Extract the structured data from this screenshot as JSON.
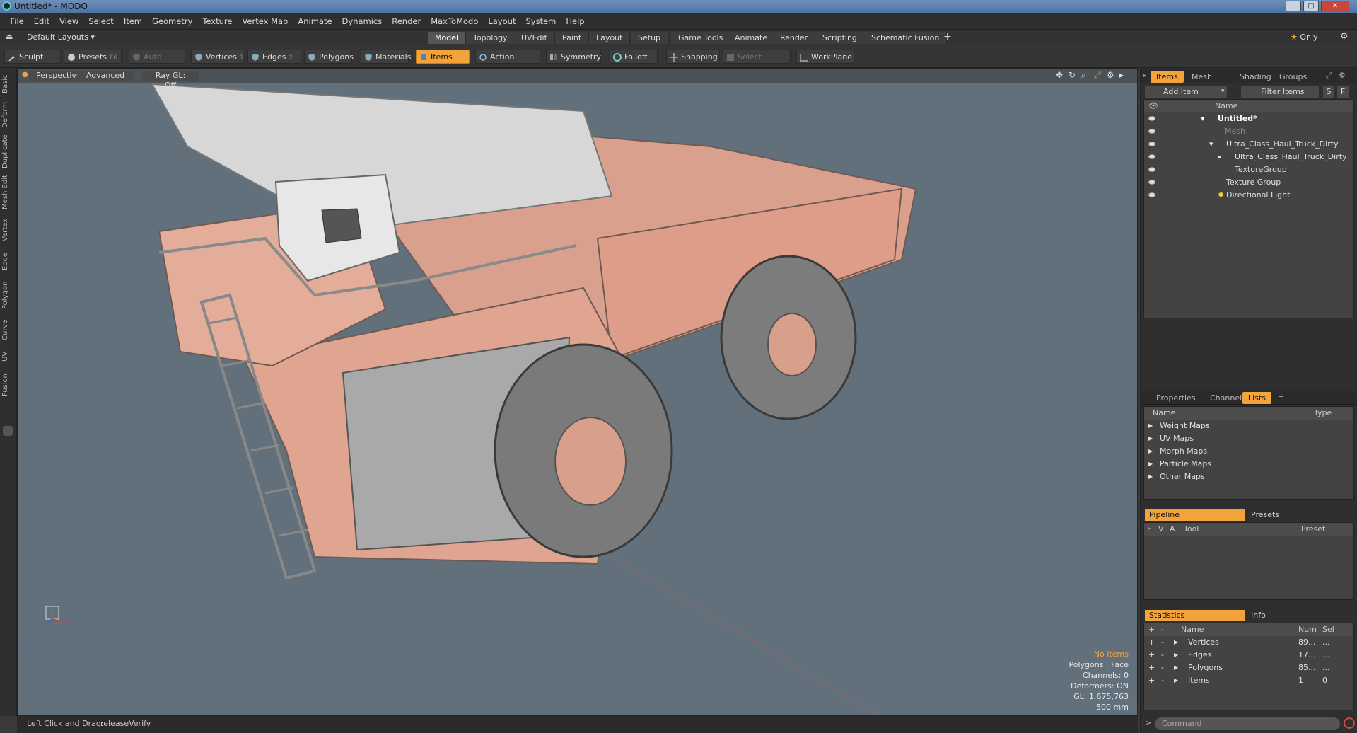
{
  "window": {
    "title": "Untitled* - MODO"
  },
  "menu": [
    "File",
    "Edit",
    "View",
    "Select",
    "Item",
    "Geometry",
    "Texture",
    "Vertex Map",
    "Animate",
    "Dynamics",
    "Render",
    "MaxToModo",
    "Layout",
    "System",
    "Help"
  ],
  "layoutbar": {
    "layout_name": "Default Layouts",
    "tabs": [
      "Model",
      "Topology",
      "UVEdit",
      "Paint",
      "Layout",
      "Setup",
      "Game Tools",
      "Animate",
      "Render",
      "Scripting",
      "Schematic Fusion"
    ],
    "active_tab": "Model",
    "plus": "+",
    "only_label": "Only"
  },
  "toolbar": {
    "sculpt": "Sculpt",
    "presets": "Presets",
    "presets_key": "F6",
    "auto_select": "Auto Select",
    "vertices": "Vertices",
    "vertices_count": "1",
    "edges": "Edges",
    "edges_count": "2",
    "polygons": "Polygons",
    "materials": "Materials",
    "items": "Items",
    "action_center": "Action Center",
    "symmetry": "Symmetry",
    "falloff": "Falloff",
    "snapping": "Snapping",
    "select_through": "Select Through",
    "workplane": "WorkPlane"
  },
  "left_tabs": [
    "Basic",
    "Deform",
    "Duplicate",
    "Mesh Edit",
    "Vertex",
    "Edge",
    "Polygon",
    "Curve",
    "UV",
    "Fusion"
  ],
  "viewport": {
    "perspective": "Perspective",
    "advanced": "Advanced",
    "raygl": "Ray GL: Off",
    "info": {
      "no_items": "No Items",
      "polygons": "Polygons : Face",
      "channels": "Channels: 0",
      "deformers": "Deformers: ON",
      "gl": "GL: 1,675,763",
      "scale": "500 mm"
    }
  },
  "status": {
    "hint": "Left Click and Drag:",
    "value": "releaseVerify"
  },
  "items_panel": {
    "tabs": [
      "Items",
      "Mesh ...",
      "Shading",
      "Groups"
    ],
    "add_item": "Add Item",
    "filter_items": "Filter Items",
    "s_btn": "S",
    "f_btn": "F",
    "col_name": "Name",
    "tree": [
      "Untitled*",
      "Mesh",
      "Ultra_Class_Haul_Truck_Dirty",
      "Ultra_Class_Haul_Truck_Dirty",
      "TextureGroup",
      "Texture Group",
      "Directional Light"
    ]
  },
  "lists_panel": {
    "tabs": [
      "Properties",
      "Channels",
      "Lists"
    ],
    "col_name": "Name",
    "col_type": "Type",
    "rows": [
      "Weight Maps",
      "UV Maps",
      "Morph Maps",
      "Particle Maps",
      "Other Maps"
    ]
  },
  "pipeline_panel": {
    "tabs": [
      "Pipeline",
      "Presets"
    ],
    "cols": [
      "E",
      "V",
      "A",
      "Tool",
      "Preset"
    ]
  },
  "stats_panel": {
    "tabs": [
      "Statistics",
      "Info"
    ],
    "cols": {
      "plus": "+",
      "minus": "-",
      "name": "Name",
      "num": "Num",
      "sel": "Sel"
    },
    "rows": [
      {
        "name": "Vertices",
        "num": "89...",
        "sel": "..."
      },
      {
        "name": "Edges",
        "num": "17...",
        "sel": "..."
      },
      {
        "name": "Polygons",
        "num": "85...",
        "sel": "..."
      },
      {
        "name": "Items",
        "num": "1",
        "sel": "0"
      }
    ]
  },
  "command": {
    "placeholder": "Command"
  }
}
